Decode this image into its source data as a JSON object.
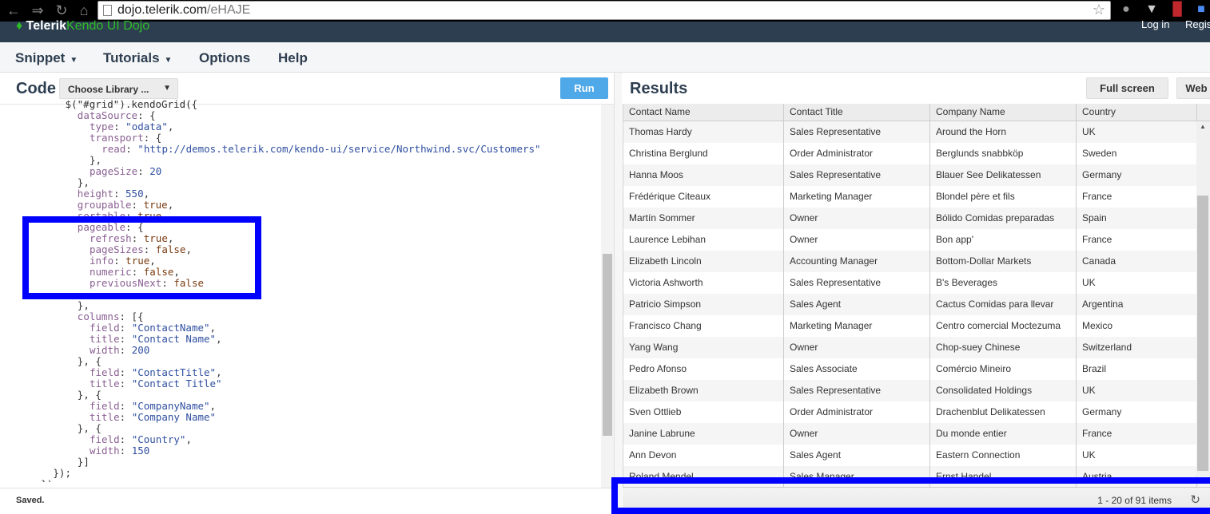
{
  "browser": {
    "url_host": "dojo.telerik.com",
    "url_path": "/eHAJE",
    "nav_icons": [
      "back-arrow-icon",
      "forward-arrow-icon",
      "reload-icon",
      "home-icon"
    ]
  },
  "topnav": {
    "logo_brand": "Telerik",
    "logo_product": "Kendo UI Dojo",
    "login": "Log in",
    "register": "Register"
  },
  "menu": [
    {
      "label": "Snippet",
      "dropdown": true
    },
    {
      "label": "Tutorials",
      "dropdown": true
    },
    {
      "label": "Options",
      "dropdown": false
    },
    {
      "label": "Help",
      "dropdown": false
    }
  ],
  "code_panel": {
    "title": "Code",
    "library_select": "Choose Library ...",
    "run_label": "Run",
    "status": "Saved.",
    "lines": [
      [
        [
          0,
          "o",
          "$(\"#grid\").kendoGrid({"
        ]
      ],
      [
        [
          2,
          "p",
          "dataSource"
        ],
        [
          0,
          "o",
          ": {"
        ]
      ],
      [
        [
          4,
          "p",
          "type"
        ],
        [
          0,
          "o",
          ": "
        ],
        [
          0,
          "s",
          "\"odata\""
        ],
        [
          0,
          "o",
          ","
        ]
      ],
      [
        [
          4,
          "p",
          "transport"
        ],
        [
          0,
          "o",
          ": {"
        ]
      ],
      [
        [
          6,
          "p",
          "read"
        ],
        [
          0,
          "o",
          ": "
        ],
        [
          0,
          "s",
          "\"http://demos.telerik.com/kendo-ui/service/Northwind.svc/Customers\""
        ]
      ],
      [
        [
          4,
          "o",
          "},"
        ]
      ],
      [
        [
          4,
          "p",
          "pageSize"
        ],
        [
          0,
          "o",
          ": "
        ],
        [
          0,
          "n",
          "20"
        ]
      ],
      [
        [
          2,
          "o",
          "},"
        ]
      ],
      [
        [
          2,
          "p",
          "height"
        ],
        [
          0,
          "o",
          ": "
        ],
        [
          0,
          "n",
          "550"
        ],
        [
          0,
          "o",
          ","
        ]
      ],
      [
        [
          2,
          "p",
          "groupable"
        ],
        [
          0,
          "o",
          ": "
        ],
        [
          0,
          "b",
          "true"
        ],
        [
          0,
          "o",
          ","
        ]
      ],
      [
        [
          2,
          "p",
          "sortable"
        ],
        [
          0,
          "o",
          ": "
        ],
        [
          0,
          "b",
          "true"
        ],
        [
          0,
          "o",
          ","
        ]
      ],
      [
        [
          2,
          "p",
          "pageable"
        ],
        [
          0,
          "o",
          ": {"
        ]
      ],
      [
        [
          4,
          "p",
          "refresh"
        ],
        [
          0,
          "o",
          ": "
        ],
        [
          0,
          "b",
          "true"
        ],
        [
          0,
          "o",
          ","
        ]
      ],
      [
        [
          4,
          "p",
          "pageSizes"
        ],
        [
          0,
          "o",
          ": "
        ],
        [
          0,
          "b",
          "false"
        ],
        [
          0,
          "o",
          ","
        ]
      ],
      [
        [
          4,
          "p",
          "info"
        ],
        [
          0,
          "o",
          ": "
        ],
        [
          0,
          "b",
          "true"
        ],
        [
          0,
          "o",
          ","
        ]
      ],
      [
        [
          4,
          "p",
          "numeric"
        ],
        [
          0,
          "o",
          ": "
        ],
        [
          0,
          "b",
          "false"
        ],
        [
          0,
          "o",
          ","
        ]
      ],
      [
        [
          4,
          "p",
          "previousNext"
        ],
        [
          0,
          "o",
          ": "
        ],
        [
          0,
          "b",
          "false"
        ]
      ],
      [],
      [
        [
          2,
          "o",
          "},"
        ]
      ],
      [
        [
          2,
          "p",
          "columns"
        ],
        [
          0,
          "o",
          ": [{"
        ]
      ],
      [
        [
          4,
          "p",
          "field"
        ],
        [
          0,
          "o",
          ": "
        ],
        [
          0,
          "s",
          "\"ContactName\""
        ],
        [
          0,
          "o",
          ","
        ]
      ],
      [
        [
          4,
          "p",
          "title"
        ],
        [
          0,
          "o",
          ": "
        ],
        [
          0,
          "s",
          "\"Contact Name\""
        ],
        [
          0,
          "o",
          ","
        ]
      ],
      [
        [
          4,
          "p",
          "width"
        ],
        [
          0,
          "o",
          ": "
        ],
        [
          0,
          "n",
          "200"
        ]
      ],
      [
        [
          2,
          "o",
          "}, {"
        ]
      ],
      [
        [
          4,
          "p",
          "field"
        ],
        [
          0,
          "o",
          ": "
        ],
        [
          0,
          "s",
          "\"ContactTitle\""
        ],
        [
          0,
          "o",
          ","
        ]
      ],
      [
        [
          4,
          "p",
          "title"
        ],
        [
          0,
          "o",
          ": "
        ],
        [
          0,
          "s",
          "\"Contact Title\""
        ]
      ],
      [
        [
          2,
          "o",
          "}, {"
        ]
      ],
      [
        [
          4,
          "p",
          "field"
        ],
        [
          0,
          "o",
          ": "
        ],
        [
          0,
          "s",
          "\"CompanyName\""
        ],
        [
          0,
          "o",
          ","
        ]
      ],
      [
        [
          4,
          "p",
          "title"
        ],
        [
          0,
          "o",
          ": "
        ],
        [
          0,
          "s",
          "\"Company Name\""
        ]
      ],
      [
        [
          2,
          "o",
          "}, {"
        ]
      ],
      [
        [
          4,
          "p",
          "field"
        ],
        [
          0,
          "o",
          ": "
        ],
        [
          0,
          "s",
          "\"Country\""
        ],
        [
          0,
          "o",
          ","
        ]
      ],
      [
        [
          4,
          "p",
          "width"
        ],
        [
          0,
          "o",
          ": "
        ],
        [
          0,
          "n",
          "150"
        ]
      ],
      [
        [
          2,
          "o",
          "}]"
        ]
      ],
      [
        [
          -2,
          "o",
          "});"
        ]
      ],
      [
        [
          -4,
          "o",
          "});"
        ]
      ]
    ]
  },
  "results_panel": {
    "title": "Results",
    "fullscreen_label": "Full screen",
    "web_label": "Web",
    "columns": [
      "Contact Name",
      "Contact Title",
      "Company Name",
      "Country"
    ],
    "rows": [
      [
        "Thomas Hardy",
        "Sales Representative",
        "Around the Horn",
        "UK"
      ],
      [
        "Christina Berglund",
        "Order Administrator",
        "Berglunds snabbköp",
        "Sweden"
      ],
      [
        "Hanna Moos",
        "Sales Representative",
        "Blauer See Delikatessen",
        "Germany"
      ],
      [
        "Frédérique Citeaux",
        "Marketing Manager",
        "Blondel père et fils",
        "France"
      ],
      [
        "Martín Sommer",
        "Owner",
        "Bólido Comidas preparadas",
        "Spain"
      ],
      [
        "Laurence Lebihan",
        "Owner",
        "Bon app'",
        "France"
      ],
      [
        "Elizabeth Lincoln",
        "Accounting Manager",
        "Bottom-Dollar Markets",
        "Canada"
      ],
      [
        "Victoria Ashworth",
        "Sales Representative",
        "B's Beverages",
        "UK"
      ],
      [
        "Patricio Simpson",
        "Sales Agent",
        "Cactus Comidas para llevar",
        "Argentina"
      ],
      [
        "Francisco Chang",
        "Marketing Manager",
        "Centro comercial Moctezuma",
        "Mexico"
      ],
      [
        "Yang Wang",
        "Owner",
        "Chop-suey Chinese",
        "Switzerland"
      ],
      [
        "Pedro Afonso",
        "Sales Associate",
        "Comércio Mineiro",
        "Brazil"
      ],
      [
        "Elizabeth Brown",
        "Sales Representative",
        "Consolidated Holdings",
        "UK"
      ],
      [
        "Sven Ottlieb",
        "Order Administrator",
        "Drachenblut Delikatessen",
        "Germany"
      ],
      [
        "Janine Labrune",
        "Owner",
        "Du monde entier",
        "France"
      ],
      [
        "Ann Devon",
        "Sales Agent",
        "Eastern Connection",
        "UK"
      ],
      [
        "Roland Mendel",
        "Sales Manager",
        "Ernst Handel",
        "Austria"
      ]
    ],
    "pager_info": "1 - 20 of 91 items"
  },
  "colors": {
    "highlight": "#0000ff",
    "nav_bg": "#2d3e50",
    "run_button": "#4fa8e8",
    "brand_green": "#2ebd26"
  }
}
